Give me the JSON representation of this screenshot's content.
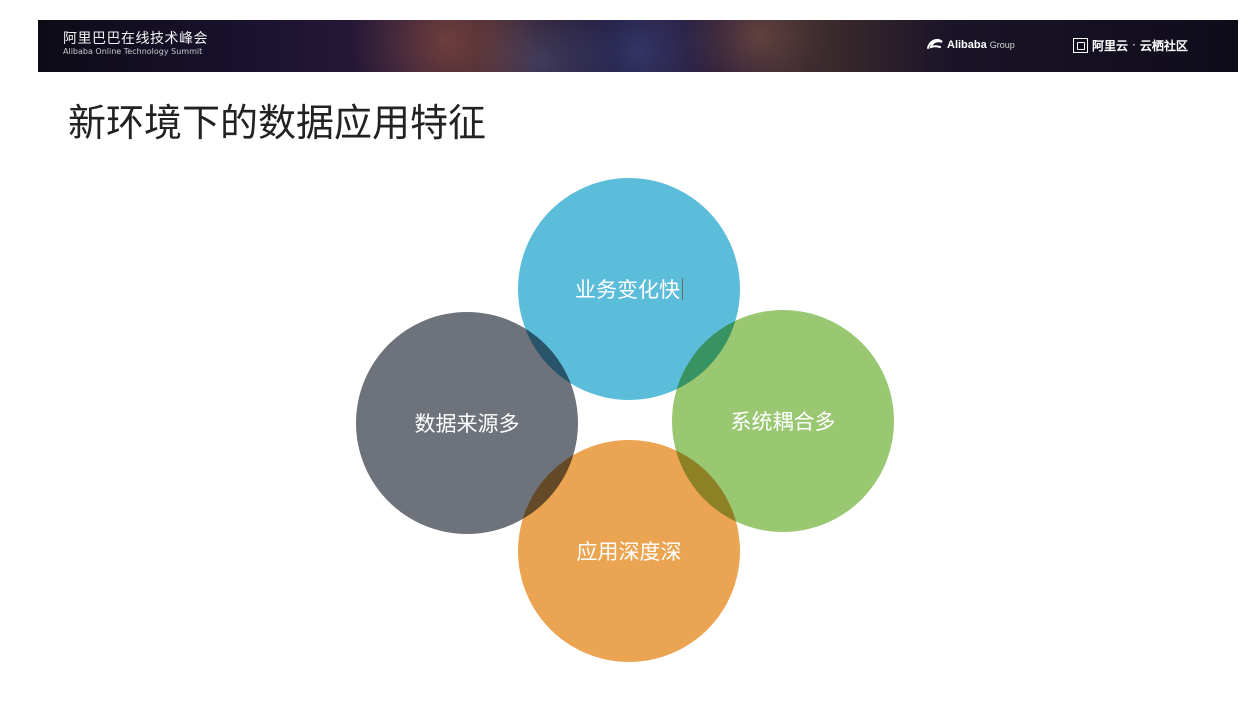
{
  "header": {
    "event_title": "阿里巴巴在线技术峰会",
    "event_subtitle": "Alibaba Online Technology Summit",
    "logo_alibaba": "Alibaba",
    "logo_alibaba_group": "Group",
    "logo_aliyun": "阿里云",
    "logo_separator": "·",
    "logo_community": "云栖社区"
  },
  "slide": {
    "title": "新环境下的数据应用特征"
  },
  "diagram": {
    "circles": [
      {
        "id": "top",
        "label": "业务变化快",
        "color": "#45b4d6"
      },
      {
        "id": "left",
        "label": "数据来源多",
        "color": "#5a5e68"
      },
      {
        "id": "right",
        "label": "系统耦合多",
        "color": "#8cc05e"
      },
      {
        "id": "bottom",
        "label": "应用深度深",
        "color": "#e8983a"
      }
    ]
  }
}
